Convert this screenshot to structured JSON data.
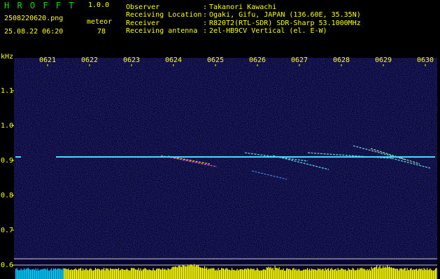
{
  "header": {
    "app_title": "H R O F F T",
    "version": "1.0.0",
    "filename": "2508220620.png",
    "datetime": "25.08.22 06:20",
    "detection_label": "meteor",
    "detection_count": "78"
  },
  "info": [
    {
      "key": "Observer",
      "sep": ":",
      "value": "Takanori Kawachi"
    },
    {
      "key": "Receiving Location",
      "sep": ":",
      "value": "Ogaki, Gifu, JAPAN (136.60E, 35.35N)"
    },
    {
      "key": "Receiver",
      "sep": ":",
      "value": "R820T2(RTL-SDR) SDR-Sharp 53.1000MHz"
    },
    {
      "key": "Receiving antenna",
      "sep": ":",
      "value": "2el-HB9CV Vertical (el. E-W)"
    }
  ],
  "chart_data": {
    "type": "heatmap",
    "ylabel": "kHz",
    "time_ticks": [
      "0621",
      "0622",
      "0623",
      "0624",
      "0625",
      "0626",
      "0627",
      "0628",
      "0629",
      "0630"
    ],
    "freq_ticks": [
      "1.1",
      "1.0",
      "0.9",
      "0.8",
      "0.7",
      "0.6"
    ],
    "freq_values": [
      1.1,
      1.0,
      0.9,
      0.8,
      0.7,
      0.6
    ],
    "carrier_freq": 0.91,
    "colors": {
      "background": "#06052a",
      "carrier": "#44ddff",
      "text": "#ffff00",
      "spectrum": "#ffff00",
      "spectrum_left": "#00d0ff",
      "grid": "#ffffff"
    }
  }
}
